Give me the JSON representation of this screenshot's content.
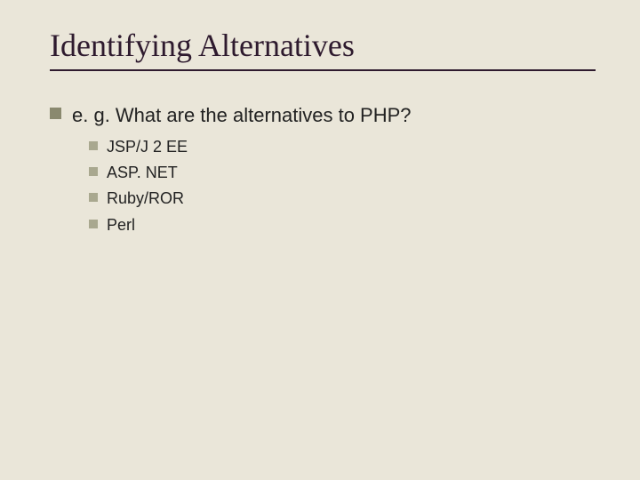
{
  "title": "Identifying Alternatives",
  "main": {
    "text": "e. g. What are the alternatives to PHP?",
    "items": [
      {
        "label": "JSP/J 2 EE"
      },
      {
        "label": "ASP. NET"
      },
      {
        "label": "Ruby/ROR"
      },
      {
        "label": "Perl"
      }
    ]
  }
}
